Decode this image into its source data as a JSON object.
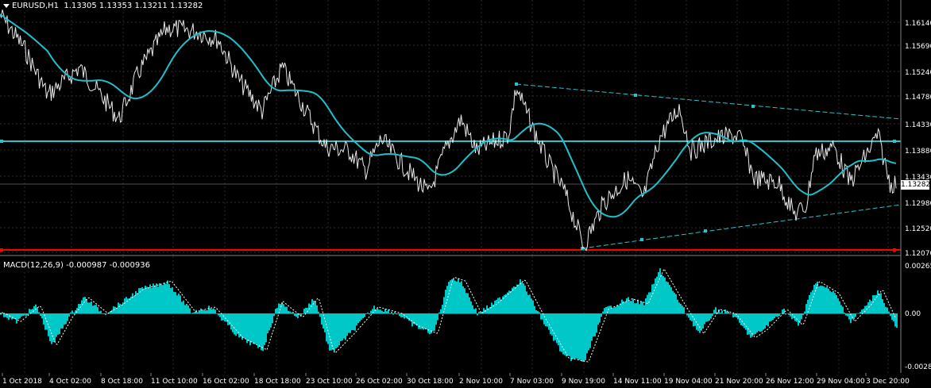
{
  "symbol": "EURUSD,H1",
  "ohlc": "1.13305 1.13353 1.13211 1.13282",
  "current_price": "1.13282",
  "macd": {
    "label": "MACD(12,26,9)",
    "values": "-0.000987 -0.000936"
  },
  "price_axis_labels": [
    "1.16140",
    "1.15690",
    "1.15240",
    "1.14780",
    "1.14330",
    "1.13880",
    "1.13430",
    "1.12980",
    "1.12520",
    "1.12070"
  ],
  "macd_axis_labels": [
    "0.002652",
    "0.00",
    "-0.002854"
  ],
  "time_axis_labels": [
    "1 Oct 2018",
    "4 Oct 02:00",
    "8 Oct 18:00",
    "11 Oct 10:00",
    "16 Oct 02:00",
    "18 Oct 18:00",
    "23 Oct 10:00",
    "26 Oct 02:00",
    "30 Oct 18:00",
    "2 Nov 10:00",
    "7 Nov 03:00",
    "9 Nov 19:00",
    "14 Nov 11:00",
    "19 Nov 04:00",
    "21 Nov 20:00",
    "26 Nov 12:00",
    "29 Nov 04:00",
    "3 Dec 20:00"
  ],
  "colors": {
    "background": "#000000",
    "grid": "#3a3a3a",
    "price": "#e8e8e8",
    "ma": "#20c0c8",
    "level": "#28c4cc",
    "support": "#ff0000",
    "histogram": "#00c8c8",
    "signal": "#ffffff",
    "text": "#ffffff"
  }
}
